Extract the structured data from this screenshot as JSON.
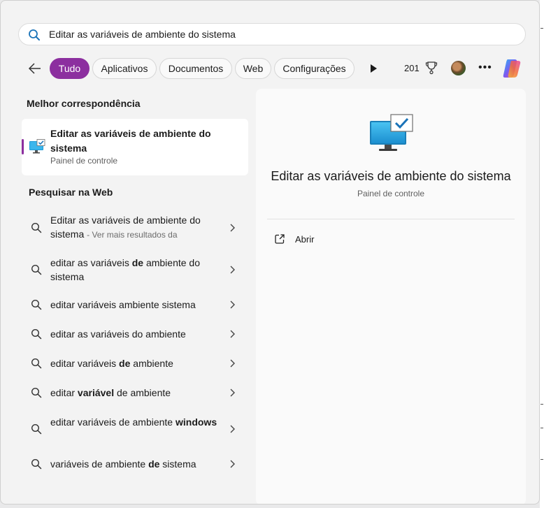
{
  "search": {
    "query": "Editar as variáveis de ambiente do sistema"
  },
  "filters": [
    {
      "label": "Tudo"
    },
    {
      "label": "Aplicativos"
    },
    {
      "label": "Documentos"
    },
    {
      "label": "Web"
    },
    {
      "label": "Configurações"
    }
  ],
  "rewards": {
    "points": "201"
  },
  "best_match": {
    "heading": "Melhor correspondência",
    "title": "Editar as variáveis de ambiente do sistema",
    "subtitle": "Painel de controle"
  },
  "web": {
    "heading": "Pesquisar na Web",
    "items": [
      {
        "parts": [
          "Editar as variáveis de ambiente do sistema"
        ],
        "suffix": "- Ver mais resultados da"
      },
      {
        "parts": [
          "editar as variáveis ",
          "de",
          " ambiente do sistema"
        ]
      },
      {
        "parts": [
          "editar variáveis ambiente sistema"
        ]
      },
      {
        "parts": [
          "editar as variáveis do ambiente"
        ]
      },
      {
        "parts": [
          "editar variáveis ",
          "de",
          " ambiente"
        ]
      },
      {
        "parts": [
          "editar ",
          "variável",
          " de ambiente"
        ]
      },
      {
        "parts": [
          "editar variáveis de ambiente ",
          "windows"
        ]
      },
      {
        "parts": [
          "variáveis de ambiente ",
          "de",
          " sistema"
        ]
      }
    ]
  },
  "detail": {
    "title": "Editar as variáveis de ambiente do sistema",
    "subtitle": "Painel de controle",
    "action_open": "Abrir"
  },
  "colors": {
    "accent": "#8c2f9f",
    "monitor": "#1f9ad6"
  }
}
